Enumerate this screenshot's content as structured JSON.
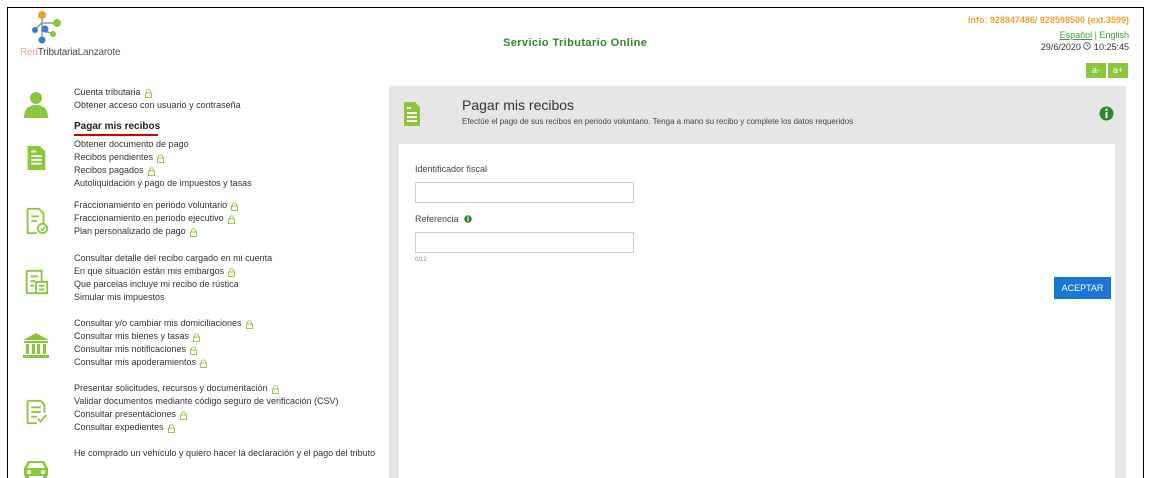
{
  "header": {
    "logo": {
      "part1": "Red",
      "part2": "Tributaria",
      "part3": "Lanzarote"
    },
    "site_title": "Servicio Tributario Online",
    "info": "Info: 928847486/ 928598500 (ext.3599)",
    "lang_selected": "Español",
    "lang_sep": " | ",
    "lang_other": "English",
    "date": "29/6/2020",
    "time": "10:25:45",
    "zoom_out": "a-",
    "zoom_in": "a+"
  },
  "sidebar": {
    "groups": [
      {
        "icon": "user-icon",
        "items": [
          {
            "label": "Cuenta tributaria",
            "locked": true
          },
          {
            "label": "Obtener acceso con usuario y contraseña",
            "locked": false
          },
          {
            "label": "Pagar mis recibos",
            "locked": false,
            "active": true
          },
          {
            "label": "Obtener documento de pago",
            "locked": false
          },
          {
            "label": "Recibos pendientes",
            "locked": true
          },
          {
            "label": "Recibos pagados",
            "locked": true
          },
          {
            "label": "Autoliquidación y pago de impuestos y tasas",
            "locked": false
          }
        ]
      },
      {
        "icon": "installments-icon",
        "items": [
          {
            "label": "Fraccionamiento en periodo voluntario",
            "locked": true
          },
          {
            "label": "Fraccionamiento en periodo ejecutivo",
            "locked": true
          },
          {
            "label": "Plan personalizado de pago",
            "locked": true
          }
        ]
      },
      {
        "icon": "query-icon",
        "items": [
          {
            "label": "Consultar detalle del recibo cargado en mi cuenta",
            "locked": false
          },
          {
            "label": "En que situación están mis embargos",
            "locked": true
          },
          {
            "label": "Que parcelas incluye mi recibo de rústica",
            "locked": false
          },
          {
            "label": "Simular mis impuestos",
            "locked": false
          }
        ]
      },
      {
        "icon": "bank-icon",
        "items": [
          {
            "label": "Consultar y/o cambiar mis domiciliaciones",
            "locked": true
          },
          {
            "label": "Consultar mis bienes y tasas",
            "locked": true
          },
          {
            "label": "Consultar mis notificaciones",
            "locked": true
          },
          {
            "label": "Consultar mis apoderamientos",
            "locked": true
          }
        ]
      },
      {
        "icon": "checklist-icon",
        "items": [
          {
            "label": "Presentar solicitudes, recursos y documentación",
            "locked": true
          },
          {
            "label": "Validar documentos mediante código seguro de verificación (CSV)",
            "locked": false
          },
          {
            "label": "Consultar presentaciones",
            "locked": true
          },
          {
            "label": "Consultar expedientes",
            "locked": true
          }
        ]
      },
      {
        "icon": "car-icon",
        "items": [
          {
            "label": "He comprado un vehículo y quiero hacer la declaración y el pago del tributo",
            "locked": false
          }
        ]
      }
    ]
  },
  "main": {
    "title": "Pagar mis recibos",
    "subtitle": "Efectúe el pago de sus recibos en periodo voluntario. Tenga a mano su recibo y complete los datos requeridos",
    "fields": {
      "fiscal_label": "Identificador fiscal",
      "fiscal_value": "",
      "reference_label": "Referencia",
      "reference_value": "",
      "reference_counter": "0/12"
    },
    "accept_label": "ACEPTAR"
  },
  "colors": {
    "green": "#8cc63e",
    "dark_green": "#2c8a2c",
    "orange": "#f0a030",
    "blue": "#1976d2",
    "active_underline": "#d40000"
  }
}
